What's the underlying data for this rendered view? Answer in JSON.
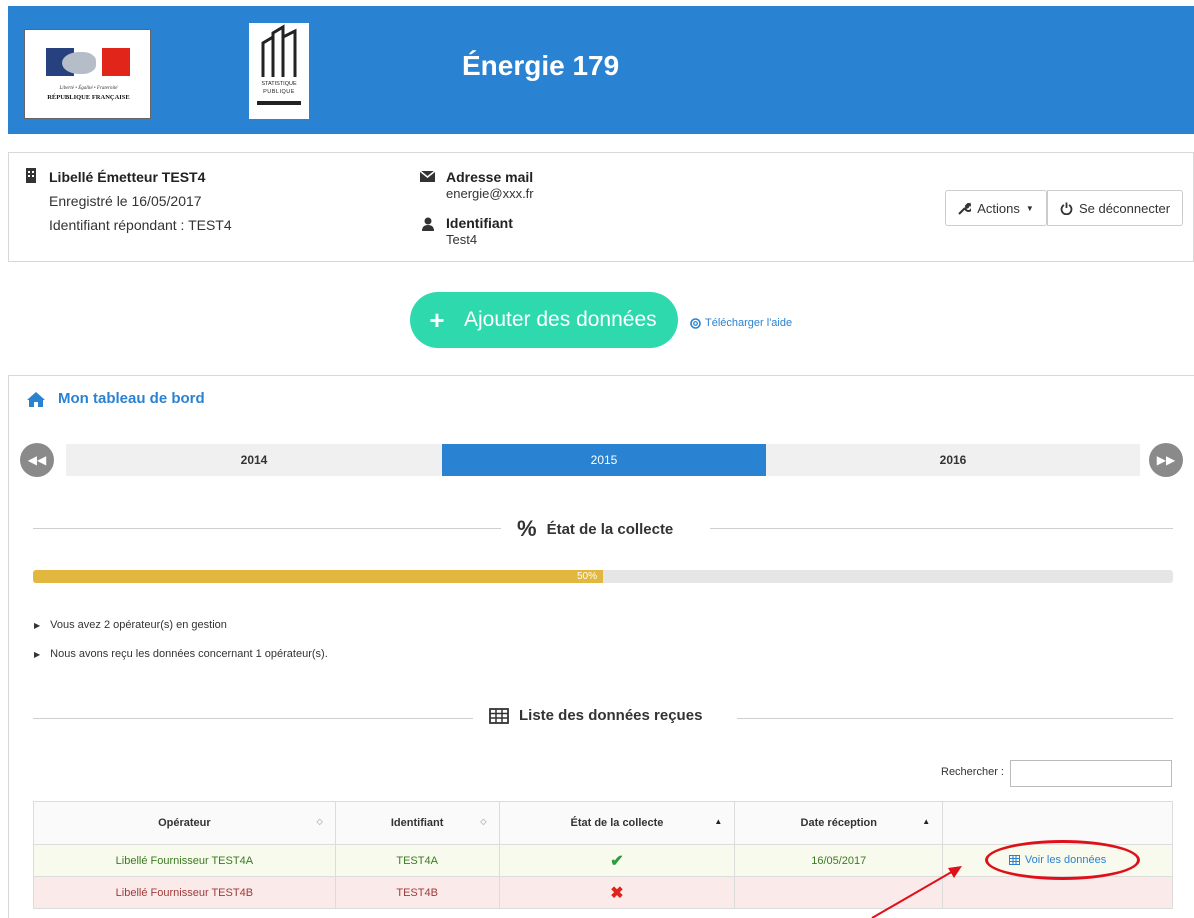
{
  "header": {
    "title": "Énergie 179",
    "logo_left": {
      "motto": "Liberté • Égalité • Fraternité",
      "name": "RÉPUBLIQUE FRANÇAISE"
    },
    "logo_right": {
      "line1": "STATISTIQUE",
      "line2": "PUBLIQUE"
    },
    "bar_color": "#2a82d2"
  },
  "user": {
    "emitter_label": "Libellé Émetteur TEST4",
    "registered": "Enregistré le 16/05/2017",
    "respondent_id": "Identifiant répondant : TEST4",
    "email_label": "Adresse mail",
    "email_value": "energie@xxx.fr",
    "id_label": "Identifiant",
    "id_value": "Test4",
    "actions_label": "Actions",
    "logout_label": "Se déconnecter"
  },
  "add": {
    "button_label": "Ajouter des données",
    "help_link": "Télécharger l'aide",
    "button_color": "#2ed9ad"
  },
  "dashboard": {
    "title": "Mon tableau de bord",
    "years": [
      "2014",
      "2015",
      "2016"
    ],
    "active_year": "2015",
    "collection_title": "État de la collecte",
    "progress_percent": 50,
    "progress_label": "50%",
    "progress_color": "#e2b740",
    "bullets": [
      "Vous avez 2 opérateur(s) en gestion",
      "Nous avons reçu les données concernant 1 opérateur(s)."
    ],
    "list_title": "Liste des données reçues",
    "search_label": "Rechercher :",
    "search_value": ""
  },
  "table": {
    "headers": [
      "Opérateur",
      "Identifiant",
      "État de la collecte",
      "Date réception",
      ""
    ],
    "rows": [
      {
        "operator": "Libellé Fournisseur TEST4A",
        "id": "TEST4A",
        "status": "check-icon",
        "date": "16/05/2017",
        "action": "Voir les données"
      },
      {
        "operator": "Libellé Fournisseur TEST4B",
        "id": "TEST4B",
        "status": "cross-icon",
        "date": "",
        "action": ""
      }
    ]
  },
  "annotation": {
    "color": "#e0101a",
    "highlight": "Voir les données"
  }
}
